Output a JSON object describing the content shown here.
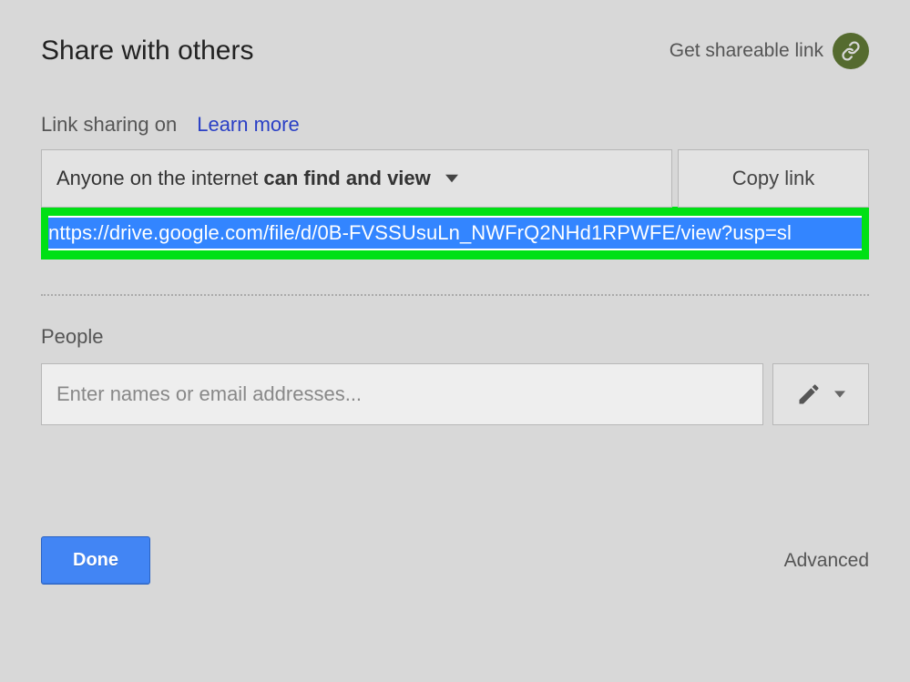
{
  "header": {
    "title": "Share with others",
    "get_link_label": "Get shareable link"
  },
  "link_sharing": {
    "status_label": "Link sharing on",
    "learn_more": "Learn more",
    "permission_prefix": "Anyone on the internet",
    "permission_bold": "can find and view",
    "copy_link_label": "Copy link",
    "url": "nttps://drive.google.com/file/d/0B-FVSSUsuLn_NWFrQ2NHd1RPWFE/view?usp=sl"
  },
  "people": {
    "section_label": "People",
    "input_placeholder": "Enter names or email addresses..."
  },
  "footer": {
    "done_label": "Done",
    "advanced_label": "Advanced"
  }
}
